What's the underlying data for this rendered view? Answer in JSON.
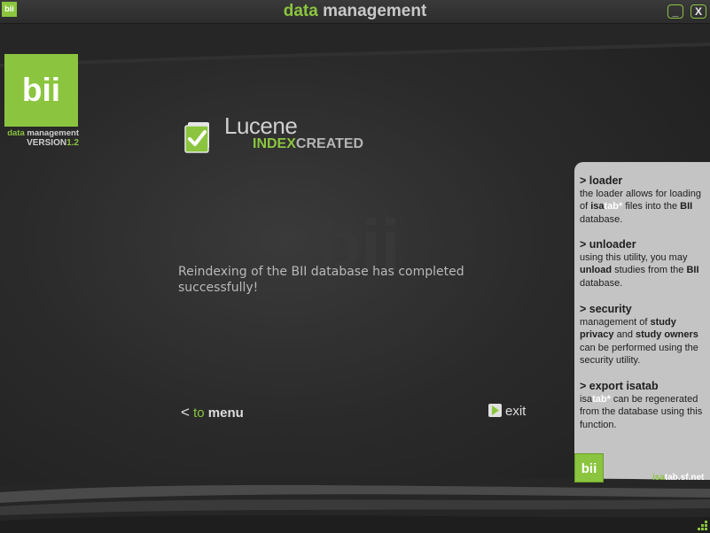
{
  "window": {
    "icon_text": "bii",
    "title_part1": "data",
    "title_part2": "management",
    "minimize_label": "_",
    "close_label": "X"
  },
  "logo": {
    "text": "bii",
    "sub1": "data",
    "sub2": "management",
    "version_label": "VERSION",
    "version_number": "1.2"
  },
  "watermark": "bii",
  "header": {
    "title": "Lucene",
    "sub_green": "INDEX",
    "sub_white": "CREATED"
  },
  "message": "Reindexing of the BII database has completed successfully!",
  "nav": {
    "back_chevron": "<",
    "back_to": "to",
    "back_menu": "menu",
    "exit_label": "exit"
  },
  "help": {
    "loader": {
      "title": "> loader",
      "t1": "the loader allows for loading of ",
      "isa": "isa",
      "tab": "tab*",
      "t2": " files into the ",
      "bii": "BII",
      "t3": " database."
    },
    "unloader": {
      "title": "> unloader",
      "t1": "using this utility, you may ",
      "unload": "unload",
      "t2": " studies from the ",
      "bii": "BII",
      "t3": " database."
    },
    "security": {
      "title": "> security",
      "t1": "management of ",
      "study_privacy": "study privacy",
      "and": " and ",
      "study_owners": "study owners",
      "t2": " can be performed using the security utility."
    },
    "export": {
      "title": "> export isatab",
      "isa": "isa",
      "tab": "tab*",
      "t1": " can be regenerated from the database using this function."
    }
  },
  "panel_logo": "bii",
  "isatab_link": {
    "part1": "isa",
    "part2": "tab.sf.net"
  },
  "colors": {
    "accent": "#8bc53f",
    "panel": "#c4c4c4",
    "background": "#2a2a2a"
  }
}
